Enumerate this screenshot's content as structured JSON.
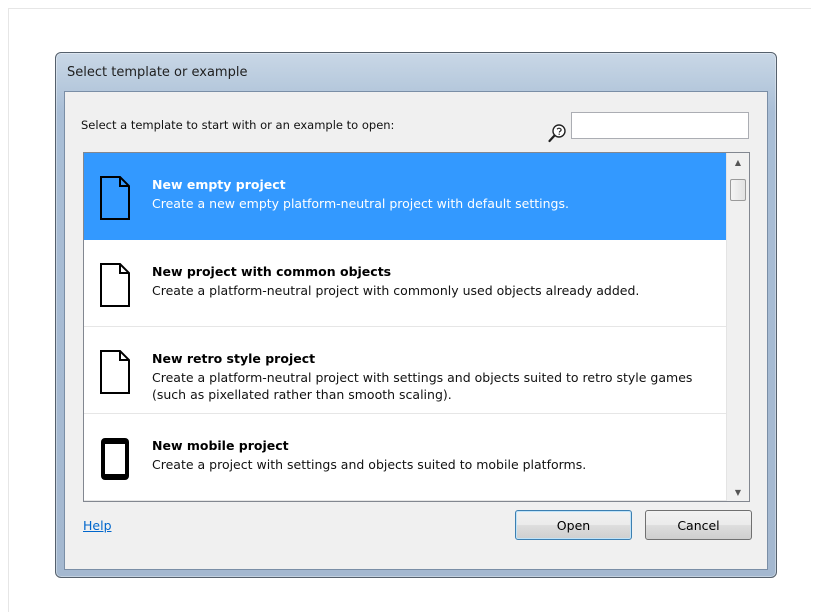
{
  "dialog": {
    "title": "Select template or example",
    "prompt": "Select a template to start with or an example to open:",
    "search": {
      "value": "",
      "placeholder": ""
    },
    "items": [
      {
        "title": "New empty project",
        "description": "Create a new empty platform-neutral project with default settings.",
        "icon": "document-icon",
        "selected": true
      },
      {
        "title": "New project with common objects",
        "description": "Create a platform-neutral project with commonly used objects already added.",
        "icon": "document-icon",
        "selected": false
      },
      {
        "title": "New retro style project",
        "description": "Create a platform-neutral project with settings and objects suited to retro style games (such as pixellated rather than smooth scaling).",
        "icon": "document-icon",
        "selected": false
      },
      {
        "title": "New mobile project",
        "description": "Create a project with settings and objects suited to mobile platforms.",
        "icon": "mobile-phone-icon",
        "selected": false
      }
    ],
    "help_label": "Help",
    "open_label": "Open",
    "cancel_label": "Cancel"
  },
  "colors": {
    "selection": "#3399ff",
    "link": "#0066cc"
  }
}
